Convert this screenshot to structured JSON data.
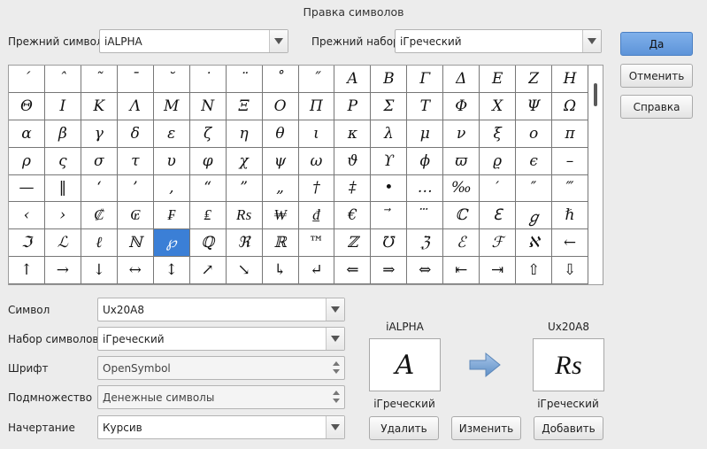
{
  "dialog": {
    "title": "Правка символов"
  },
  "old_symbol": {
    "label": "Прежний символ",
    "value": "iALPHA"
  },
  "old_set": {
    "label": "Прежний набор",
    "value": "iГреческий"
  },
  "buttons": {
    "ok": "Да",
    "cancel": "Отменить",
    "help": "Справка",
    "delete": "Удалить",
    "modify": "Изменить",
    "add": "Добавить"
  },
  "grid": {
    "selected_index": 100,
    "symbols": [
      "´",
      "ˆ",
      "˜",
      "¯",
      "˘",
      "˙",
      "¨",
      "˚",
      "˝",
      "Α",
      "Β",
      "Γ",
      "Δ",
      "Ε",
      "Ζ",
      "Η",
      "Θ",
      "Ι",
      "Κ",
      "Λ",
      "Μ",
      "Ν",
      "Ξ",
      "Ο",
      "Π",
      "Ρ",
      "Σ",
      "Τ",
      "Φ",
      "Χ",
      "Ψ",
      "Ω",
      "α",
      "β",
      "γ",
      "δ",
      "ε",
      "ζ",
      "η",
      "θ",
      "ι",
      "κ",
      "λ",
      "μ",
      "ν",
      "ξ",
      "ο",
      "π",
      "ρ",
      "ς",
      "σ",
      "τ",
      "υ",
      "φ",
      "χ",
      "ψ",
      "ω",
      "ϑ",
      "ϒ",
      "ϕ",
      "ϖ",
      "ϱ",
      "ϵ",
      "–",
      "—",
      "‖",
      "‘",
      "’",
      "‚",
      "“",
      "”",
      "„",
      "†",
      "‡",
      "•",
      "…",
      "‰",
      "′",
      "″",
      "‴",
      "‹",
      "›",
      "₡",
      "₢",
      "₣",
      "₤",
      "₨",
      "₩",
      "₫",
      "€",
      "⃗",
      "⃛",
      "ℂ",
      "ℇ",
      "ℊ",
      "ℏ",
      "ℑ",
      "ℒ",
      "ℓ",
      "ℕ",
      "℘",
      "ℚ",
      "ℜ",
      "ℝ",
      "™",
      "ℤ",
      "℧",
      "ℨ",
      "ℰ",
      "ℱ",
      "ℵ",
      "←",
      "↑",
      "→",
      "↓",
      "↔",
      "↕",
      "↗",
      "↘",
      "↳",
      "↵",
      "⇐",
      "⇒",
      "⇔",
      "⇤",
      "⇥",
      "⇧",
      "⇩"
    ]
  },
  "form": {
    "symbol": {
      "label": "Символ",
      "value": "Ux20A8"
    },
    "symbol_set": {
      "label": "Набор символов",
      "value": "iГреческий"
    },
    "font": {
      "label": "Шрифт",
      "value": "OpenSymbol"
    },
    "subset": {
      "label": "Подмножество",
      "value": "Денежные символы"
    },
    "style": {
      "label": "Начертание",
      "value": "Курсив"
    }
  },
  "preview_old": {
    "name": "iALPHA",
    "glyph": "Α",
    "set": "iГреческий"
  },
  "preview_new": {
    "name": "Ux20A8",
    "glyph": "₨",
    "set": "iГреческий"
  },
  "colors": {
    "selection": "#3b7fd6",
    "default_button": "#6aa0e2",
    "arrow": "#7aa6d6"
  }
}
